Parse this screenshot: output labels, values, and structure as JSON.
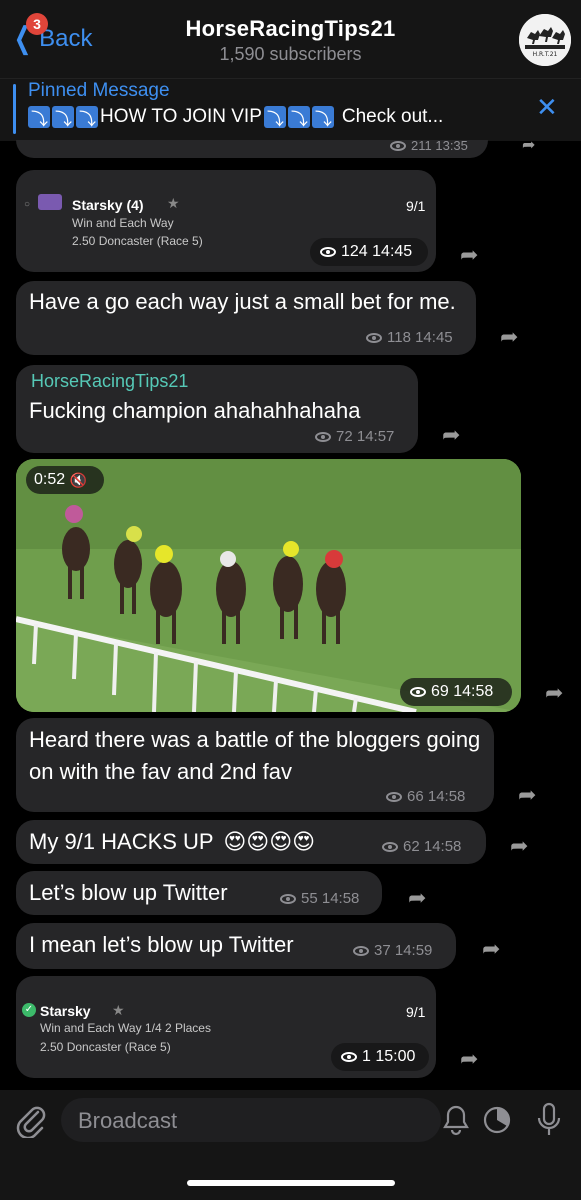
{
  "header": {
    "back_label": "Back",
    "back_badge": "3",
    "title": "HorseRacingTips21",
    "subtitle": "1,590 subscribers",
    "avatar_text": "H.R.T.21"
  },
  "pinned": {
    "label": "Pinned Message",
    "text": "HOW TO JOIN VIP",
    "text_after": "Check out..."
  },
  "messages": [
    {
      "type": "partial",
      "views": "211",
      "time": "13:35"
    },
    {
      "type": "card",
      "name": "Starsky (4)",
      "odds": "9/1",
      "line1": "Win and Each Way",
      "line2": "2.50 Doncaster (Race 5)",
      "views": "124",
      "time": "14:45"
    },
    {
      "type": "text",
      "text": "Have a go each way just a small bet for me.",
      "views": "118",
      "time": "14:45"
    },
    {
      "type": "text",
      "sender": "HorseRacingTips21",
      "text": "Fucking champion ahahahhahaha",
      "views": "72",
      "time": "14:57"
    },
    {
      "type": "video",
      "duration": "0:52",
      "views": "69",
      "time": "14:58"
    },
    {
      "type": "text",
      "text": "Heard there was a battle of the bloggers going on with the fav and 2nd fav",
      "views": "66",
      "time": "14:58"
    },
    {
      "type": "text",
      "text": "My 9/1 HACKS UP",
      "emoji": "😍😍😍😍",
      "views": "62",
      "time": "14:58"
    },
    {
      "type": "text",
      "text": "Let’s blow up Twitter",
      "views": "55",
      "time": "14:58"
    },
    {
      "type": "text",
      "text": "I mean let’s blow up Twitter",
      "views": "37",
      "time": "14:59"
    },
    {
      "type": "card",
      "name": "Starsky",
      "odds": "9/1",
      "line1": "Win and Each Way 1/4 2 Places",
      "line2": "2.50 Doncaster (Race 5)",
      "views": "1",
      "time": "15:00"
    }
  ],
  "composer": {
    "placeholder": "Broadcast"
  },
  "colors": {
    "accent": "#3e8ff0",
    "bubble": "#262628",
    "sender": "#56c9b7",
    "badge": "#e0453a"
  }
}
